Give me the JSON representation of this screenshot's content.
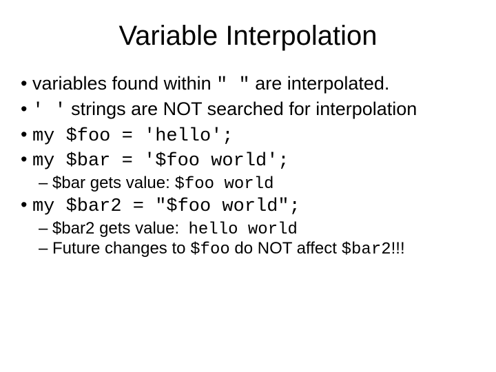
{
  "title": "Variable Interpolation",
  "b1_a": "variables found within ",
  "b1_code": "\" \"",
  "b1_b": " are interpolated.",
  "b2_code": "' '",
  "b2_b": " strings are NOT searched for interpolation",
  "b3_code": "my $foo = 'hello';",
  "b4_code": "my $bar = '$foo world';",
  "b4_1_a": "$bar gets value: ",
  "b4_1_code": "$foo world",
  "b5_code": "my $bar2 = \"$foo world\";",
  "b5_1_a": "$bar2 gets value:  ",
  "b5_1_code": "hello world",
  "b5_2_a": "Future changes to ",
  "b5_2_code1": "$foo",
  "b5_2_b": " do NOT affect ",
  "b5_2_code2": "$bar2",
  "b5_2_c": "!!!"
}
